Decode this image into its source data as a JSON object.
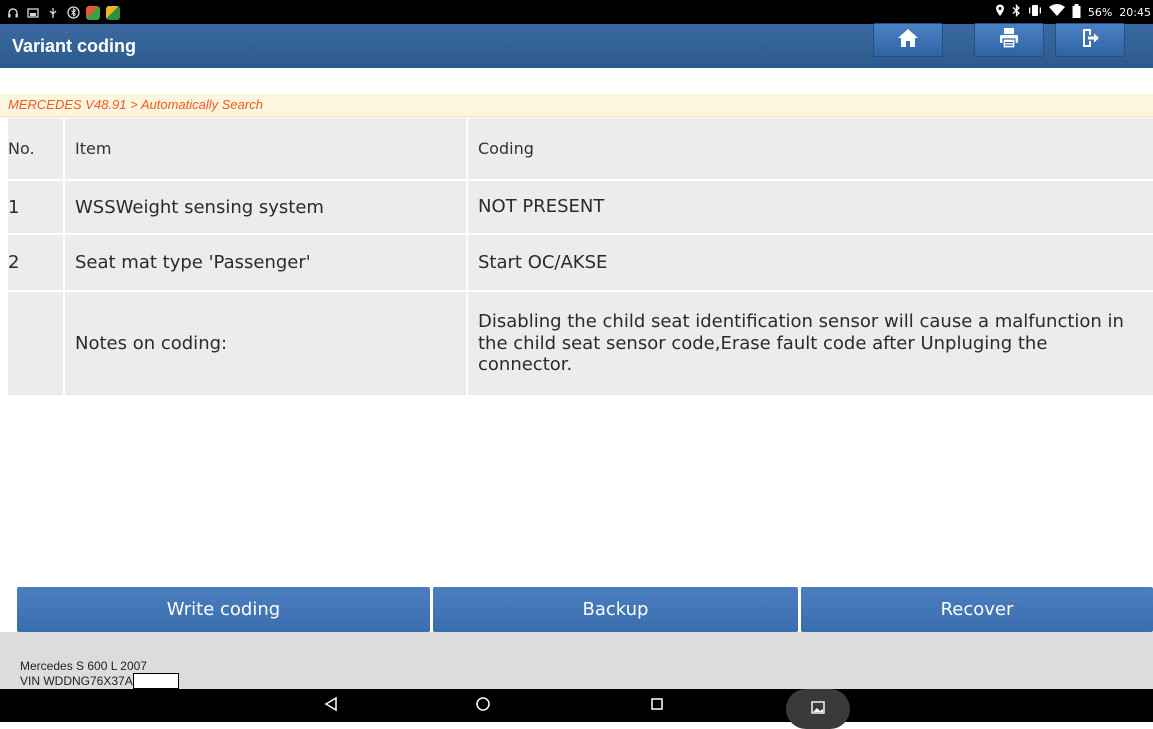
{
  "status_bar": {
    "battery": "56%",
    "time": "20:45",
    "left_icons": [
      "headset-icon",
      "screenshot-icon",
      "usb-debug-icon",
      "bluetooth-scan-icon",
      "app-icon",
      "app-icon"
    ],
    "right_icons": [
      "location-icon",
      "bluetooth-icon",
      "vibrate-icon",
      "wifi-icon",
      "battery-icon"
    ]
  },
  "header": {
    "title": "Variant coding",
    "buttons": [
      "home-icon",
      "print-icon",
      "exit-icon"
    ]
  },
  "breadcrumb": "MERCEDES V48.91 > Automatically Search",
  "table": {
    "columns": [
      "No.",
      "Item",
      "Coding"
    ],
    "rows": [
      {
        "no": "1",
        "item": "WSSWeight sensing system",
        "coding": "NOT PRESENT"
      },
      {
        "no": "2",
        "item": "Seat mat type 'Passenger'",
        "coding": "Start OC/AKSE"
      },
      {
        "no": "",
        "item": "Notes on coding:",
        "coding": "Disabling the child seat identification sensor will cause a malfunction in the child seat sensor code,Erase fault code after Unpluging the connector."
      }
    ]
  },
  "actions": {
    "write": "Write coding",
    "backup": "Backup",
    "recover": "Recover"
  },
  "vehicle": {
    "model": "Mercedes S 600 L 2007",
    "vin": "VIN WDDNG76X37A"
  },
  "colors": {
    "header_blue": "#2c5a8e",
    "button_blue": "#3a6dad",
    "breadcrumb_orange": "#ef5a1e",
    "row_gray": "#ececec"
  }
}
